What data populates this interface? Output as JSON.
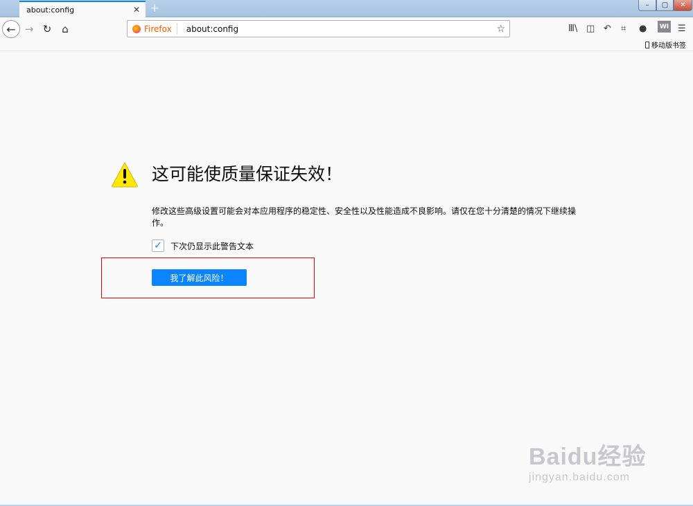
{
  "tab": {
    "title": "about:config",
    "close": "✕",
    "new_tab": "+"
  },
  "window": {
    "minimize": "–",
    "maximize": "▢",
    "close": "✕"
  },
  "nav": {
    "back": "←",
    "forward": "→",
    "reload": "↻",
    "home": "⌂"
  },
  "urlbar": {
    "identity": "Firefox",
    "url": "about:config",
    "star": "☆"
  },
  "toolbar": {
    "library": "Ⅲ\\",
    "sidebar": "◫",
    "undo": "↶",
    "crop": "⌗",
    "chat": "●",
    "wiki": "WI",
    "menu": "☰",
    "mobile_bookmarks": "移动版书签"
  },
  "warning": {
    "title": "这可能使质量保证失效！",
    "description": "修改这些高级设置可能会对本应用程序的稳定性、安全性以及性能造成不良影响。请仅在您十分清楚的情况下继续操作。",
    "checkbox_label": "下次仍显示此警告文本",
    "checkbox_checked": true,
    "checkmark": "✓",
    "button_label": "我了解此风险！"
  },
  "watermark": {
    "line1": "Baidu经验",
    "line2": "jingyan.baidu.com"
  },
  "colors": {
    "accent": "#0a84ff",
    "warning_yellow": "#ffe900",
    "highlight": "#e00000"
  }
}
